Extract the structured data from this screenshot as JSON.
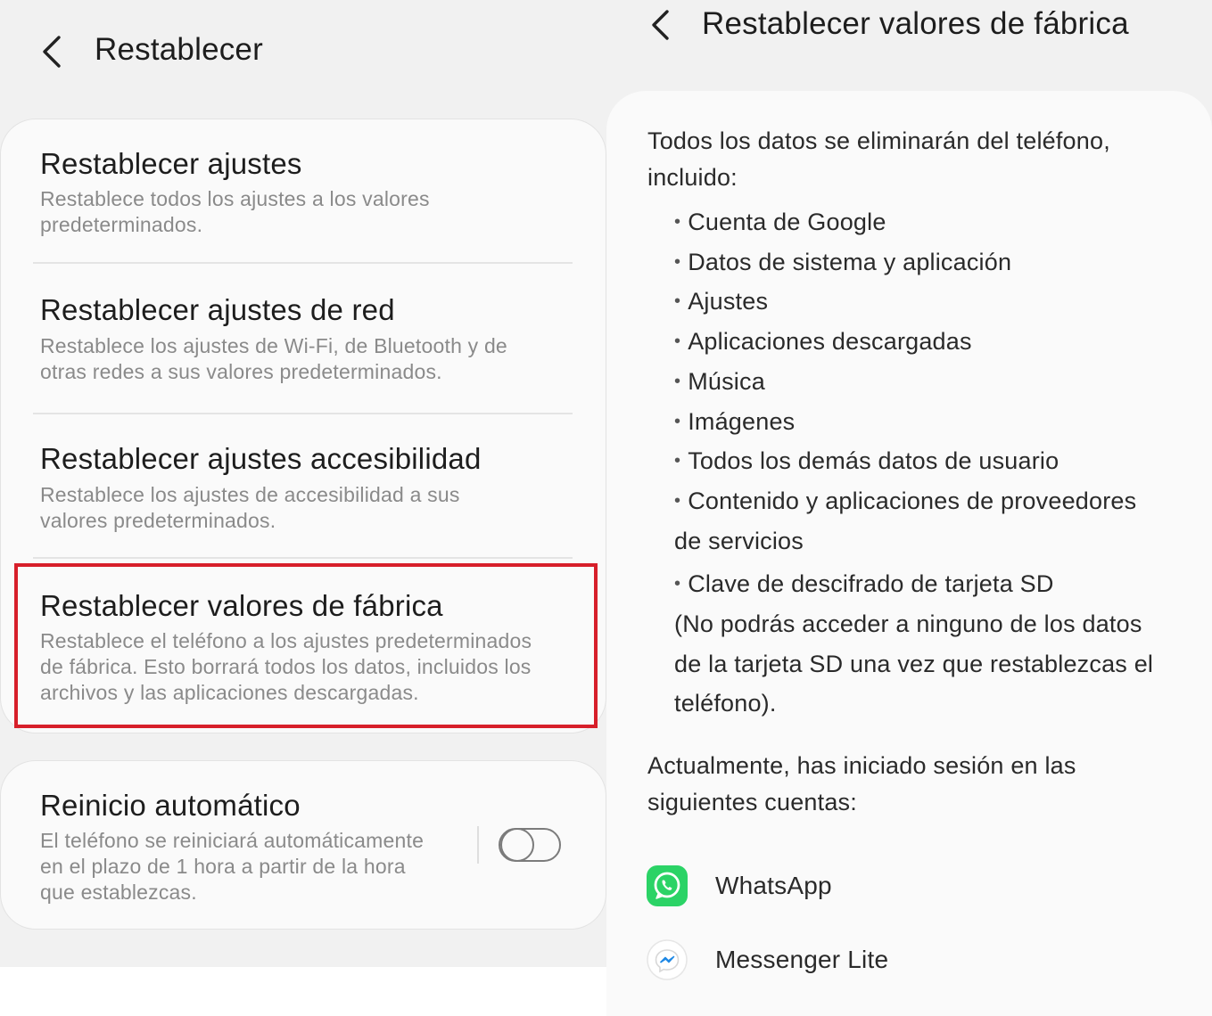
{
  "left": {
    "title": "Restablecer",
    "items": [
      {
        "title": "Restablecer ajustes",
        "desc1": "Restablece todos los ajustes a los valores",
        "desc2": "predeterminados."
      },
      {
        "title": "Restablecer ajustes de red",
        "desc1": "Restablece los ajustes de Wi-Fi, de Bluetooth y de",
        "desc2": "otras redes a sus valores predeterminados."
      },
      {
        "title": "Restablecer ajustes accesibilidad",
        "desc1": "Restablece los ajustes de accesibilidad a sus",
        "desc2": "valores predeterminados."
      },
      {
        "title": "Restablecer valores de fábrica",
        "desc1": "Restablece el teléfono a los ajustes predeterminados",
        "desc2": "de fábrica. Esto borrará todos los datos, incluidos los",
        "desc3": "archivos y las aplicaciones descargadas."
      }
    ],
    "auto_restart": {
      "title": "Reinicio automático",
      "desc1": "El teléfono se reiniciará automáticamente",
      "desc2": "en el plazo de 1 hora a partir de la hora",
      "desc3": "que establezcas.",
      "enabled": false
    },
    "highlight_color": "#d71f2a"
  },
  "right": {
    "title": "Restablecer valores de fábrica",
    "intro1": "Todos los datos se eliminarán del teléfono,",
    "intro2": "incluido:",
    "bullets": [
      "Cuenta de Google",
      "Datos de sistema y aplicación",
      "Ajustes",
      "Aplicaciones descargadas",
      "Música",
      "Imágenes",
      "Todos los demás datos de usuario",
      "Contenido y aplicaciones de proveedores",
      "Clave de descifrado de tarjeta SD"
    ],
    "bullet_cont": "de servicios",
    "note1": "(No podrás acceder a ninguno de los datos",
    "note2": "de la tarjeta SD una vez que restablezcas el",
    "note3": "teléfono).",
    "accounts_intro1": "Actualmente, has iniciado sesión en las",
    "accounts_intro2": "siguientes cuentas:",
    "accounts": [
      {
        "name": "WhatsApp",
        "icon": "whatsapp-icon",
        "color": "#25d366"
      },
      {
        "name": "Messenger Lite",
        "icon": "messenger-lite-icon",
        "color": "#1e88e5"
      }
    ]
  }
}
